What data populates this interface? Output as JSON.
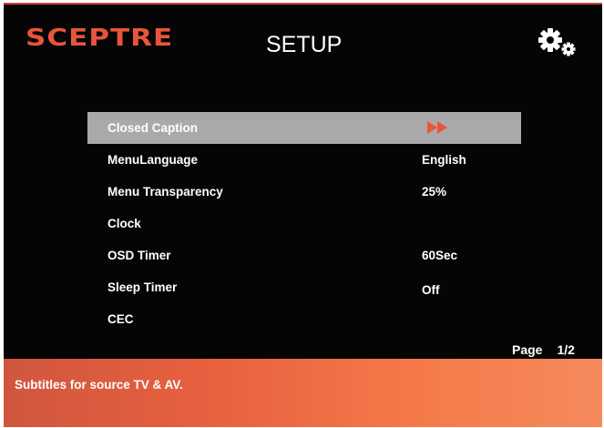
{
  "brand": {
    "logo_text": "SCEPTRE",
    "accent_color": "#e8553a"
  },
  "header": {
    "title": "SETUP",
    "settings_icon": "gears-icon"
  },
  "menu": {
    "items": [
      {
        "label": "Closed Caption",
        "value": "",
        "selected": true,
        "has_submenu": true
      },
      {
        "label": "MenuLanguage",
        "value": "English"
      },
      {
        "label": "Menu Transparency",
        "value": "25%"
      },
      {
        "label": "Clock",
        "value": ""
      },
      {
        "label": "OSD Timer",
        "value": "60Sec"
      },
      {
        "label": "Sleep Timer",
        "value": "Off"
      },
      {
        "label": "CEC",
        "value": ""
      }
    ]
  },
  "pagination": {
    "label": "Page",
    "value": "1/2"
  },
  "help_bar": {
    "text": "Subtitles for source TV & AV.",
    "color": "#e8613f"
  }
}
